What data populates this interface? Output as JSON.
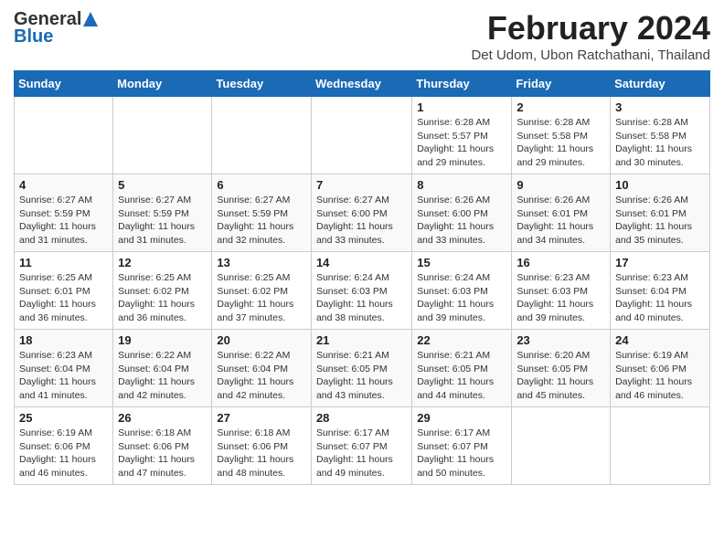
{
  "header": {
    "logo_general": "General",
    "logo_blue": "Blue",
    "month_title": "February 2024",
    "location": "Det Udom, Ubon Ratchathani, Thailand"
  },
  "days_of_week": [
    "Sunday",
    "Monday",
    "Tuesday",
    "Wednesday",
    "Thursday",
    "Friday",
    "Saturday"
  ],
  "weeks": [
    [
      {
        "day": "",
        "info": ""
      },
      {
        "day": "",
        "info": ""
      },
      {
        "day": "",
        "info": ""
      },
      {
        "day": "",
        "info": ""
      },
      {
        "day": "1",
        "info": "Sunrise: 6:28 AM\nSunset: 5:57 PM\nDaylight: 11 hours and 29 minutes."
      },
      {
        "day": "2",
        "info": "Sunrise: 6:28 AM\nSunset: 5:58 PM\nDaylight: 11 hours and 29 minutes."
      },
      {
        "day": "3",
        "info": "Sunrise: 6:28 AM\nSunset: 5:58 PM\nDaylight: 11 hours and 30 minutes."
      }
    ],
    [
      {
        "day": "4",
        "info": "Sunrise: 6:27 AM\nSunset: 5:59 PM\nDaylight: 11 hours and 31 minutes."
      },
      {
        "day": "5",
        "info": "Sunrise: 6:27 AM\nSunset: 5:59 PM\nDaylight: 11 hours and 31 minutes."
      },
      {
        "day": "6",
        "info": "Sunrise: 6:27 AM\nSunset: 5:59 PM\nDaylight: 11 hours and 32 minutes."
      },
      {
        "day": "7",
        "info": "Sunrise: 6:27 AM\nSunset: 6:00 PM\nDaylight: 11 hours and 33 minutes."
      },
      {
        "day": "8",
        "info": "Sunrise: 6:26 AM\nSunset: 6:00 PM\nDaylight: 11 hours and 33 minutes."
      },
      {
        "day": "9",
        "info": "Sunrise: 6:26 AM\nSunset: 6:01 PM\nDaylight: 11 hours and 34 minutes."
      },
      {
        "day": "10",
        "info": "Sunrise: 6:26 AM\nSunset: 6:01 PM\nDaylight: 11 hours and 35 minutes."
      }
    ],
    [
      {
        "day": "11",
        "info": "Sunrise: 6:25 AM\nSunset: 6:01 PM\nDaylight: 11 hours and 36 minutes."
      },
      {
        "day": "12",
        "info": "Sunrise: 6:25 AM\nSunset: 6:02 PM\nDaylight: 11 hours and 36 minutes."
      },
      {
        "day": "13",
        "info": "Sunrise: 6:25 AM\nSunset: 6:02 PM\nDaylight: 11 hours and 37 minutes."
      },
      {
        "day": "14",
        "info": "Sunrise: 6:24 AM\nSunset: 6:03 PM\nDaylight: 11 hours and 38 minutes."
      },
      {
        "day": "15",
        "info": "Sunrise: 6:24 AM\nSunset: 6:03 PM\nDaylight: 11 hours and 39 minutes."
      },
      {
        "day": "16",
        "info": "Sunrise: 6:23 AM\nSunset: 6:03 PM\nDaylight: 11 hours and 39 minutes."
      },
      {
        "day": "17",
        "info": "Sunrise: 6:23 AM\nSunset: 6:04 PM\nDaylight: 11 hours and 40 minutes."
      }
    ],
    [
      {
        "day": "18",
        "info": "Sunrise: 6:23 AM\nSunset: 6:04 PM\nDaylight: 11 hours and 41 minutes."
      },
      {
        "day": "19",
        "info": "Sunrise: 6:22 AM\nSunset: 6:04 PM\nDaylight: 11 hours and 42 minutes."
      },
      {
        "day": "20",
        "info": "Sunrise: 6:22 AM\nSunset: 6:04 PM\nDaylight: 11 hours and 42 minutes."
      },
      {
        "day": "21",
        "info": "Sunrise: 6:21 AM\nSunset: 6:05 PM\nDaylight: 11 hours and 43 minutes."
      },
      {
        "day": "22",
        "info": "Sunrise: 6:21 AM\nSunset: 6:05 PM\nDaylight: 11 hours and 44 minutes."
      },
      {
        "day": "23",
        "info": "Sunrise: 6:20 AM\nSunset: 6:05 PM\nDaylight: 11 hours and 45 minutes."
      },
      {
        "day": "24",
        "info": "Sunrise: 6:19 AM\nSunset: 6:06 PM\nDaylight: 11 hours and 46 minutes."
      }
    ],
    [
      {
        "day": "25",
        "info": "Sunrise: 6:19 AM\nSunset: 6:06 PM\nDaylight: 11 hours and 46 minutes."
      },
      {
        "day": "26",
        "info": "Sunrise: 6:18 AM\nSunset: 6:06 PM\nDaylight: 11 hours and 47 minutes."
      },
      {
        "day": "27",
        "info": "Sunrise: 6:18 AM\nSunset: 6:06 PM\nDaylight: 11 hours and 48 minutes."
      },
      {
        "day": "28",
        "info": "Sunrise: 6:17 AM\nSunset: 6:07 PM\nDaylight: 11 hours and 49 minutes."
      },
      {
        "day": "29",
        "info": "Sunrise: 6:17 AM\nSunset: 6:07 PM\nDaylight: 11 hours and 50 minutes."
      },
      {
        "day": "",
        "info": ""
      },
      {
        "day": "",
        "info": ""
      }
    ]
  ]
}
